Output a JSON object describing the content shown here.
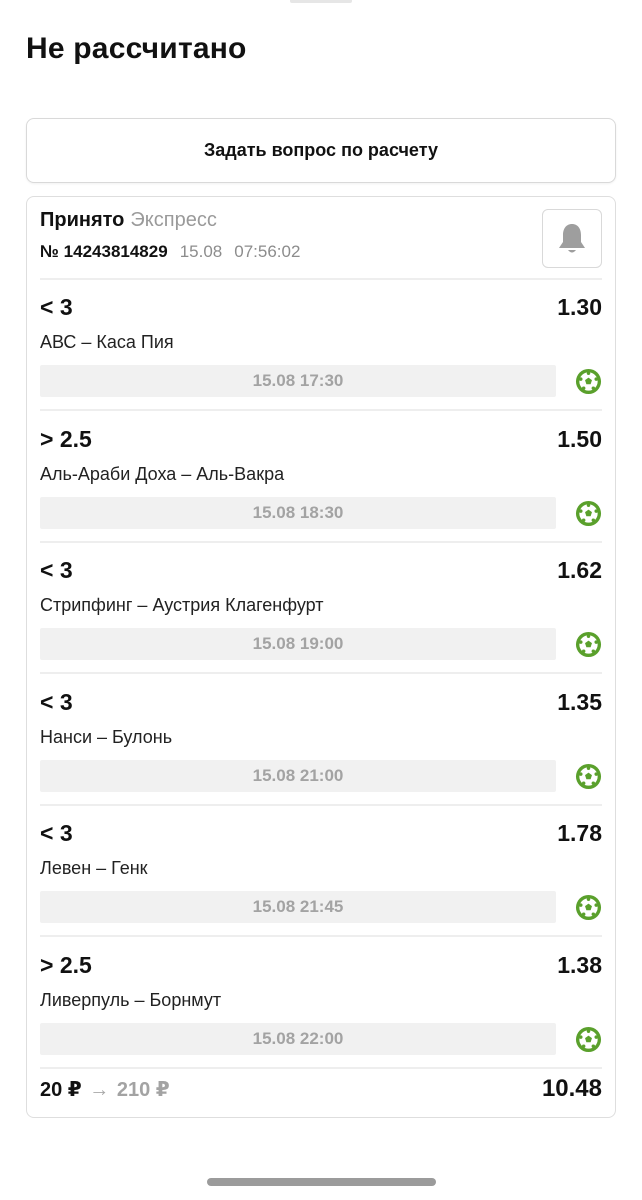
{
  "page": {
    "title": "Не рассчитано",
    "ask_button_label": "Задать вопрос по расчету"
  },
  "bet": {
    "status": "Принято",
    "type": "Экспресс",
    "number": "№ 14243814829",
    "date": "15.08",
    "time": "07:56:02",
    "icons": {
      "notify": "bell-icon",
      "sport": "soccer-ball-icon"
    },
    "events": [
      {
        "outcome": "< 3",
        "odds": "1.30",
        "teams": "АВС – Каса Пия",
        "start": "15.08 17:30"
      },
      {
        "outcome": "> 2.5",
        "odds": "1.50",
        "teams": "Аль-Араби Доха – Аль-Вакра",
        "start": "15.08 18:30"
      },
      {
        "outcome": "< 3",
        "odds": "1.62",
        "teams": "Стрипфинг – Аустрия Клагенфурт",
        "start": "15.08 19:00"
      },
      {
        "outcome": "< 3",
        "odds": "1.35",
        "teams": "Нанси – Булонь",
        "start": "15.08 21:00"
      },
      {
        "outcome": "< 3",
        "odds": "1.78",
        "teams": "Левен – Генк",
        "start": "15.08 21:45"
      },
      {
        "outcome": "> 2.5",
        "odds": "1.38",
        "teams": "Ливерпуль – Борнмут",
        "start": "15.08 22:00"
      }
    ],
    "stake": "20 ₽",
    "arrow": "→",
    "payout": "210 ₽",
    "total_odds": "10.48"
  },
  "colors": {
    "sport_icon": "#5aa02c",
    "muted_text": "#9a9a9a",
    "time_bar_bg": "#f1f1f1"
  }
}
